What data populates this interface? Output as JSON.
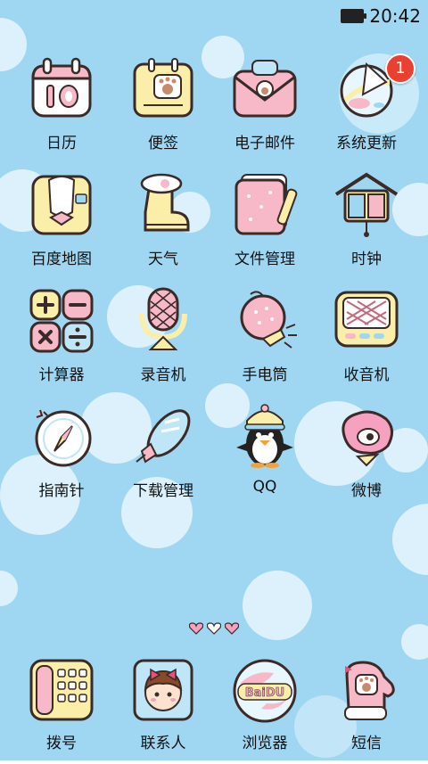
{
  "status_bar": {
    "time": "20:42",
    "battery_icon": "battery-icon"
  },
  "apps": [
    {
      "label": "日历",
      "icon": "calendar-icon",
      "badge": ""
    },
    {
      "label": "便签",
      "icon": "notes-icon",
      "badge": ""
    },
    {
      "label": "电子邮件",
      "icon": "email-icon",
      "badge": ""
    },
    {
      "label": "系统更新",
      "icon": "system-update-icon",
      "badge": "1"
    },
    {
      "label": "百度地图",
      "icon": "map-icon",
      "badge": ""
    },
    {
      "label": "天气",
      "icon": "weather-boot-icon",
      "badge": ""
    },
    {
      "label": "文件管理",
      "icon": "file-manager-icon",
      "badge": ""
    },
    {
      "label": "时钟",
      "icon": "clock-house-icon",
      "badge": ""
    },
    {
      "label": "计算器",
      "icon": "calculator-icon",
      "badge": ""
    },
    {
      "label": "录音机",
      "icon": "recorder-icon",
      "badge": ""
    },
    {
      "label": "手电筒",
      "icon": "flashlight-icon",
      "badge": ""
    },
    {
      "label": "收音机",
      "icon": "radio-icon",
      "badge": ""
    },
    {
      "label": "指南针",
      "icon": "compass-icon",
      "badge": ""
    },
    {
      "label": "下载管理",
      "icon": "download-rocket-icon",
      "badge": ""
    },
    {
      "label": "QQ",
      "icon": "qq-penguin-icon",
      "badge": ""
    },
    {
      "label": "微博",
      "icon": "weibo-icon",
      "badge": ""
    }
  ],
  "page_indicator": {
    "pages": 3,
    "current": 1
  },
  "dock": [
    {
      "label": "拨号",
      "icon": "phone-dialer-icon"
    },
    {
      "label": "联系人",
      "icon": "contacts-icon"
    },
    {
      "label": "浏览器",
      "icon": "browser-icon",
      "icon_text": "BaiDU"
    },
    {
      "label": "短信",
      "icon": "messages-mitten-icon"
    }
  ],
  "colors": {
    "background": "#9fd7f2",
    "bubble": "#e6f6fd",
    "badge": "#e9402f",
    "pink": "#f7b8c8",
    "yellow": "#fbeea8",
    "outline": "#3a2a28"
  }
}
